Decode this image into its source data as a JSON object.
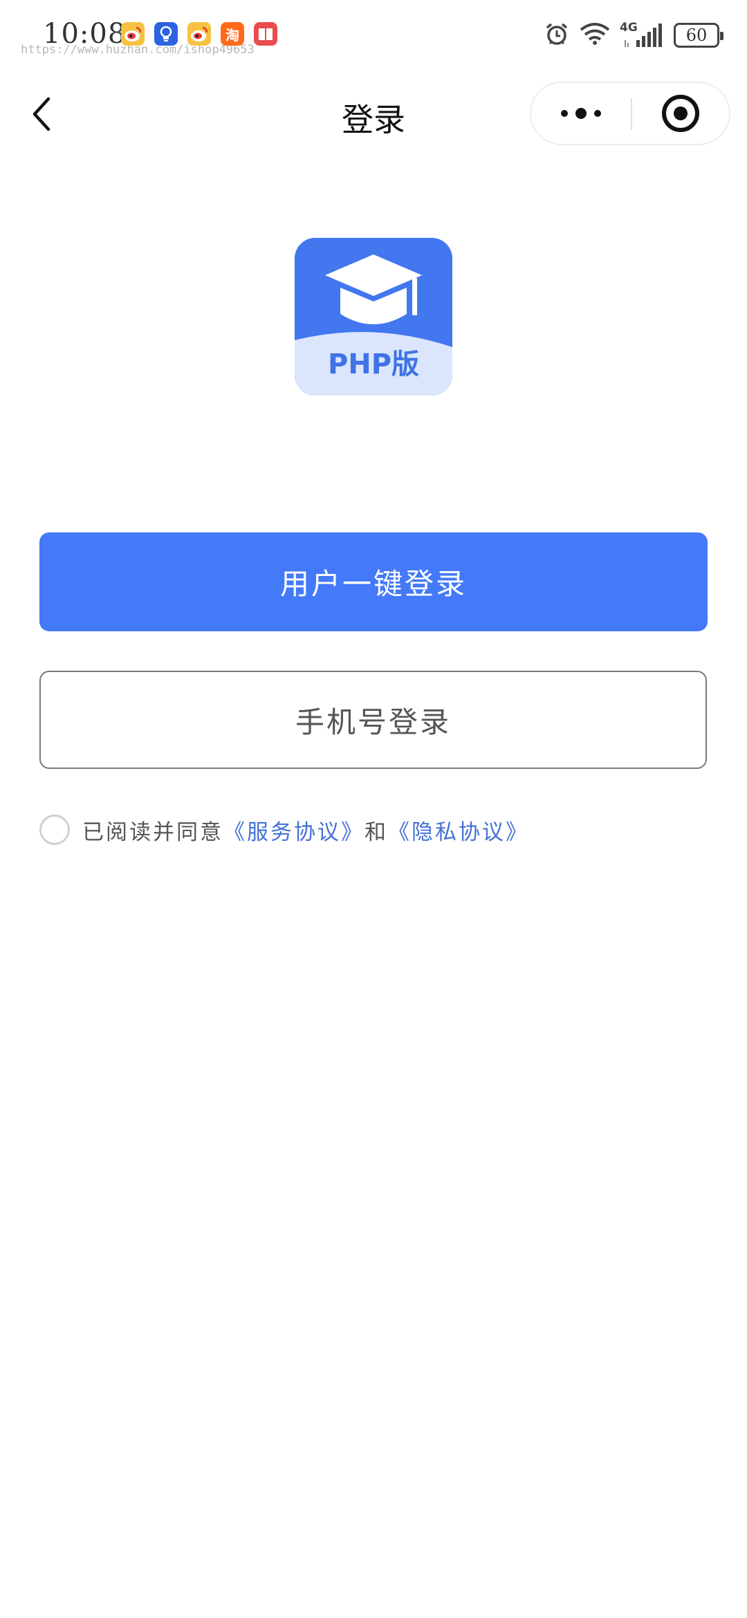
{
  "status_bar": {
    "time": "10:08",
    "watermark": "https://www.huzhan.com/ishop49653",
    "battery": "60",
    "network": "4G",
    "notification_icons": [
      "weibo-icon",
      "bulb-icon",
      "weibo-icon",
      "taobao-icon",
      "book-icon"
    ],
    "taobao_glyph": "淘"
  },
  "nav": {
    "title": "登录"
  },
  "logo": {
    "label": "PHP版",
    "colors": {
      "primary": "#4277ef",
      "light": "#dbe6fd"
    }
  },
  "buttons": {
    "one_click_login": "用户一键登录",
    "phone_login": "手机号登录"
  },
  "agreement": {
    "prefix": "已阅读并同意",
    "service_link": "《服务协议》",
    "connector": "和",
    "privacy_link": "《隐私协议》"
  },
  "colors": {
    "primary_button": "#4479f8",
    "link": "#4470d6"
  }
}
